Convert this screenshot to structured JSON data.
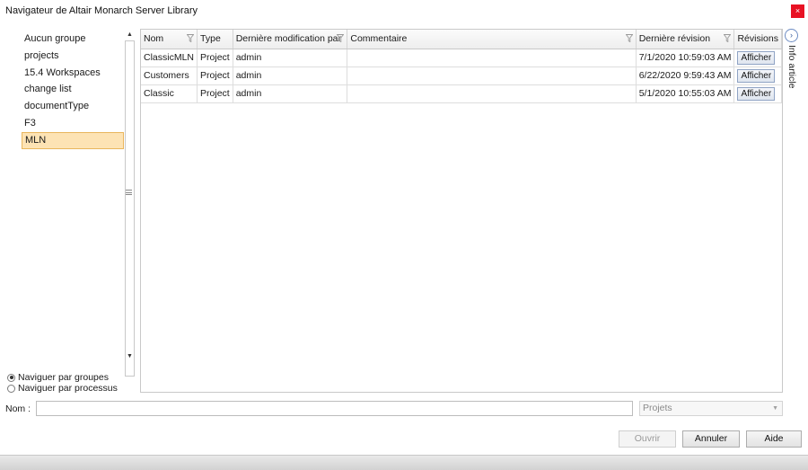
{
  "window": {
    "title": "Navigateur de Altair Monarch Server Library",
    "close_glyph": "×"
  },
  "groups": {
    "items": [
      "Aucun groupe",
      "projects",
      "15.4 Workspaces",
      "change list",
      "documentType",
      "F3",
      "MLN"
    ],
    "selected": "MLN"
  },
  "browse_mode": {
    "by_groups_label": "Naviguer par groupes",
    "by_process_label": "Naviguer par processus",
    "selected": "by_groups"
  },
  "grid": {
    "columns": {
      "nom": "Nom",
      "type": "Type",
      "modified_by": "Dernière modification par",
      "comment": "Commentaire",
      "last_revision": "Dernière révision",
      "revisions": "Révisions"
    },
    "rows": [
      {
        "nom": "ClassicMLN",
        "type": "Project",
        "modified_by": "admin",
        "comment": "",
        "last_revision": "7/1/2020 10:59:03 AM",
        "revisions_button": "Afficher"
      },
      {
        "nom": "Customers",
        "type": "Project",
        "modified_by": "admin",
        "comment": "",
        "last_revision": "6/22/2020 9:59:43 AM",
        "revisions_button": "Afficher"
      },
      {
        "nom": "Classic",
        "type": "Project",
        "modified_by": "admin",
        "comment": "",
        "last_revision": "5/1/2020 10:55:03 AM",
        "revisions_button": "Afficher"
      }
    ]
  },
  "info_panel": {
    "label": "Info article",
    "toggle_glyph": "›"
  },
  "name_field": {
    "label": "Nom :",
    "value": ""
  },
  "type_select": {
    "selected": "Projets"
  },
  "buttons": {
    "open": "Ouvrir",
    "cancel": "Annuler",
    "help": "Aide"
  },
  "icons": {
    "filter": "filter-icon",
    "scroll_up": "▲",
    "scroll_down": "▼",
    "select_chevron": "▼"
  }
}
